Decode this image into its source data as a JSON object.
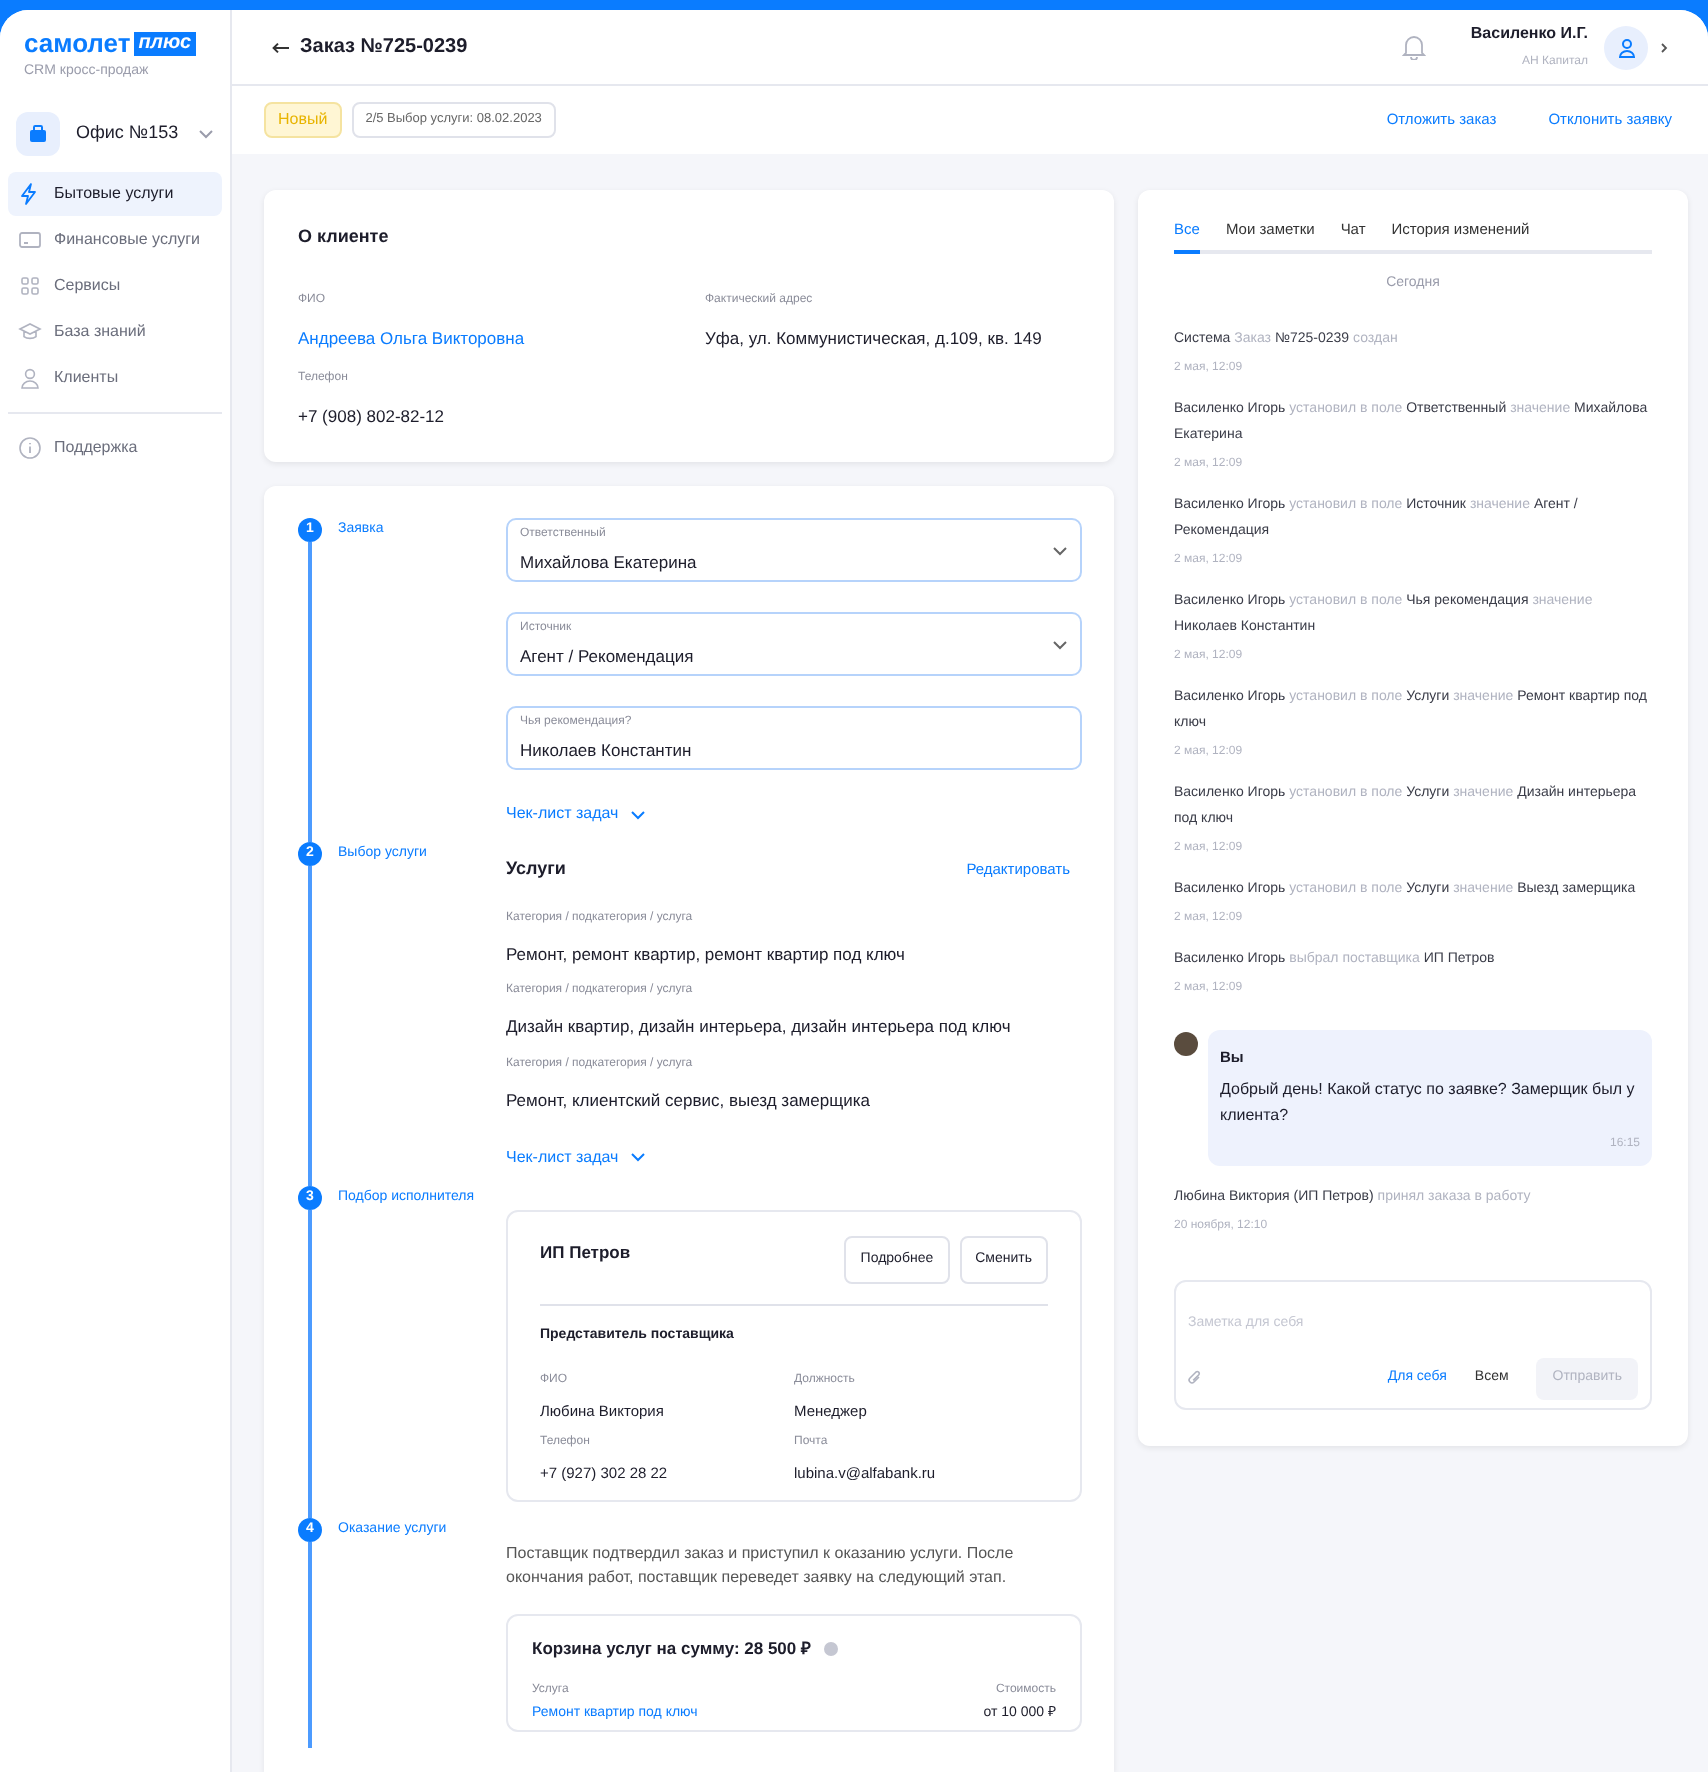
{
  "logo": {
    "brand": "самолет",
    "badge": "плюс",
    "subtitle": "CRM кросс-продаж"
  },
  "office": {
    "name": "Офис №153"
  },
  "sidebar": {
    "items": [
      {
        "label": "Бытовые услуги",
        "selected": true
      },
      {
        "label": "Финансовые услуги",
        "selected": false
      },
      {
        "label": "Сервисы",
        "selected": false
      },
      {
        "label": "База знаний",
        "selected": false
      },
      {
        "label": "Клиенты",
        "selected": false
      }
    ],
    "footer_items": [
      {
        "label": "Поддержка",
        "selected": false
      }
    ]
  },
  "header": {
    "title": "Заказ №725-0239",
    "user": {
      "name": "Василенко И.Г.",
      "company": "АН Капитал"
    }
  },
  "status_bar": {
    "badge": "Новый",
    "stage": "2/5 Выбор услуги: 08.02.2023",
    "actions": [
      "Отложить заказ",
      "Отклонить заявку"
    ]
  },
  "client": {
    "title": "О клиенте",
    "fields": [
      {
        "label": "ФИО",
        "value": "Андреева Ольга Викторовна",
        "kind": "link"
      },
      {
        "label": "Фактический адрес",
        "value": "Уфа, ул. Коммунистическая, д.109, кв. 149",
        "kind": "text"
      },
      {
        "label": "Телефон",
        "value": "+7 (908) 802-82-12",
        "kind": "text"
      }
    ]
  },
  "steps": [
    {
      "number": "1",
      "title": "Заявка",
      "kind": "form",
      "fields": [
        {
          "label": "Ответственный",
          "value": "Михайлова Екатерина",
          "kind": "select"
        },
        {
          "label": "Источник",
          "value": "Агент / Рекомендация",
          "kind": "select"
        },
        {
          "label": "Чья рекомендация?",
          "value": "Николаев Константин",
          "kind": "input"
        }
      ],
      "checklist": "Чек-лист задач"
    },
    {
      "number": "2",
      "title": "Выбор услуги",
      "kind": "services",
      "heading": "Услуги",
      "edit": "Редактировать",
      "services": [
        {
          "label": "Категория / подкатегория / услуга",
          "value": "Ремонт, ремонт квартир, ремонт квартир под ключ"
        },
        {
          "label": "Категория / подкатегория / услуга",
          "value": "Дизайн квартир, дизайн интерьера, дизайн интерьера под ключ"
        },
        {
          "label": "Категория / подкатегория / услуга",
          "value": "Ремонт, клиентский сервис, выезд замерщика"
        }
      ],
      "checklist": "Чек-лист задач"
    },
    {
      "number": "3",
      "title": "Подбор исполнителя",
      "kind": "supplier",
      "supplier": "ИП Петров",
      "buttons": [
        "Подробнее",
        "Сменить"
      ],
      "section": "Представитель поставщика",
      "fields": [
        {
          "label": "ФИО",
          "value": "Любина Виктория"
        },
        {
          "label": "Должность",
          "value": "Менеджер"
        },
        {
          "label": "Телефон",
          "value": "+7 (927) 302 28 22"
        },
        {
          "label": "Почта",
          "value": "lubina.v@alfabank.ru"
        }
      ]
    },
    {
      "number": "4",
      "title": "Оказание услуги",
      "kind": "service",
      "description": "Поставщик подтвердил заказ и приступил к оказанию услуги. После окончания работ, поставщик переведет заявку на следующий этап.",
      "basket": {
        "title": "Корзина услуг на сумму: 28 500 ₽",
        "columns": [
          "Услуга",
          "Стоимость"
        ],
        "rows": [
          {
            "service": "Ремонт квартир под ключ",
            "price": "от 10 000 ₽"
          }
        ]
      }
    }
  ],
  "activity": {
    "tabs": [
      {
        "label": "Все",
        "selected": true
      },
      {
        "label": "Мои заметки",
        "selected": false
      },
      {
        "label": "Чат",
        "selected": false
      },
      {
        "label": "История изменений",
        "selected": false
      }
    ],
    "day": "Сегодня",
    "entries": [
      {
        "kind": "event",
        "time": "2 мая, 12:09",
        "parts": [
          {
            "text": "Система",
            "strong": true
          },
          {
            "text": "Заказ",
            "strong": false
          },
          {
            "text": "№725-0239",
            "strong": true
          },
          {
            "text": "создан",
            "strong": false
          }
        ]
      },
      {
        "kind": "event",
        "time": "2 мая, 12:09",
        "parts": [
          {
            "text": "Василенко Игорь",
            "strong": true
          },
          {
            "text": "установил в поле",
            "strong": false
          },
          {
            "text": "Ответственный",
            "strong": true
          },
          {
            "text": "значение",
            "strong": false
          },
          {
            "text": "Михайлова Екатерина",
            "strong": true
          }
        ]
      },
      {
        "kind": "event",
        "time": "2 мая, 12:09",
        "parts": [
          {
            "text": "Василенко Игорь",
            "strong": true
          },
          {
            "text": "установил в поле",
            "strong": false
          },
          {
            "text": "Источник",
            "strong": true
          },
          {
            "text": "значение",
            "strong": false
          },
          {
            "text": "Агент / Рекомендация",
            "strong": true
          }
        ]
      },
      {
        "kind": "event",
        "time": "2 мая, 12:09",
        "parts": [
          {
            "text": "Василенко Игорь",
            "strong": true
          },
          {
            "text": "установил в поле",
            "strong": false
          },
          {
            "text": "Чья рекомендация",
            "strong": true
          },
          {
            "text": "значение",
            "strong": false
          },
          {
            "text": "Николаев Константин",
            "strong": true
          }
        ]
      },
      {
        "kind": "event",
        "time": "2 мая, 12:09",
        "parts": [
          {
            "text": "Василенко Игорь",
            "strong": true
          },
          {
            "text": "установил в поле",
            "strong": false
          },
          {
            "text": "Услуги",
            "strong": true
          },
          {
            "text": "значение",
            "strong": false
          },
          {
            "text": "Ремонт квартир под ключ",
            "strong": true
          }
        ]
      },
      {
        "kind": "event",
        "time": "2 мая, 12:09",
        "parts": [
          {
            "text": "Василенко Игорь",
            "strong": true
          },
          {
            "text": "установил в поле",
            "strong": false
          },
          {
            "text": "Услуги",
            "strong": true
          },
          {
            "text": "значение",
            "strong": false
          },
          {
            "text": "Дизайн интерьера под ключ",
            "strong": true
          }
        ]
      },
      {
        "kind": "event",
        "time": "2 мая, 12:09",
        "parts": [
          {
            "text": "Василенко Игорь",
            "strong": true
          },
          {
            "text": "установил в поле",
            "strong": false
          },
          {
            "text": "Услуги",
            "strong": true
          },
          {
            "text": "значение",
            "strong": false
          },
          {
            "text": "Выезд замерщика",
            "strong": true
          }
        ]
      },
      {
        "kind": "event",
        "time": "2 мая, 12:09",
        "parts": [
          {
            "text": "Василенко Игорь",
            "strong": true
          },
          {
            "text": "выбрал поставщика",
            "strong": false
          },
          {
            "text": "ИП Петров",
            "strong": true
          }
        ]
      },
      {
        "kind": "message",
        "author": "Вы",
        "text": "Добрый день! Какой статус по заявке? Замерщик был у клиента?",
        "time": "16:15"
      },
      {
        "kind": "event",
        "time": "20 ноября, 12:10",
        "parts": [
          {
            "text": "Любина Виктория (ИП Петров)",
            "strong": true
          },
          {
            "text": "принял заказа в работу",
            "strong": false
          }
        ]
      }
    ],
    "note": {
      "placeholder": "Заметка для себя",
      "audiences": [
        {
          "label": "Для себя",
          "selected": true
        },
        {
          "label": "Всем",
          "selected": false
        }
      ],
      "send": {
        "label": "Отправить",
        "disabled": true
      }
    }
  }
}
